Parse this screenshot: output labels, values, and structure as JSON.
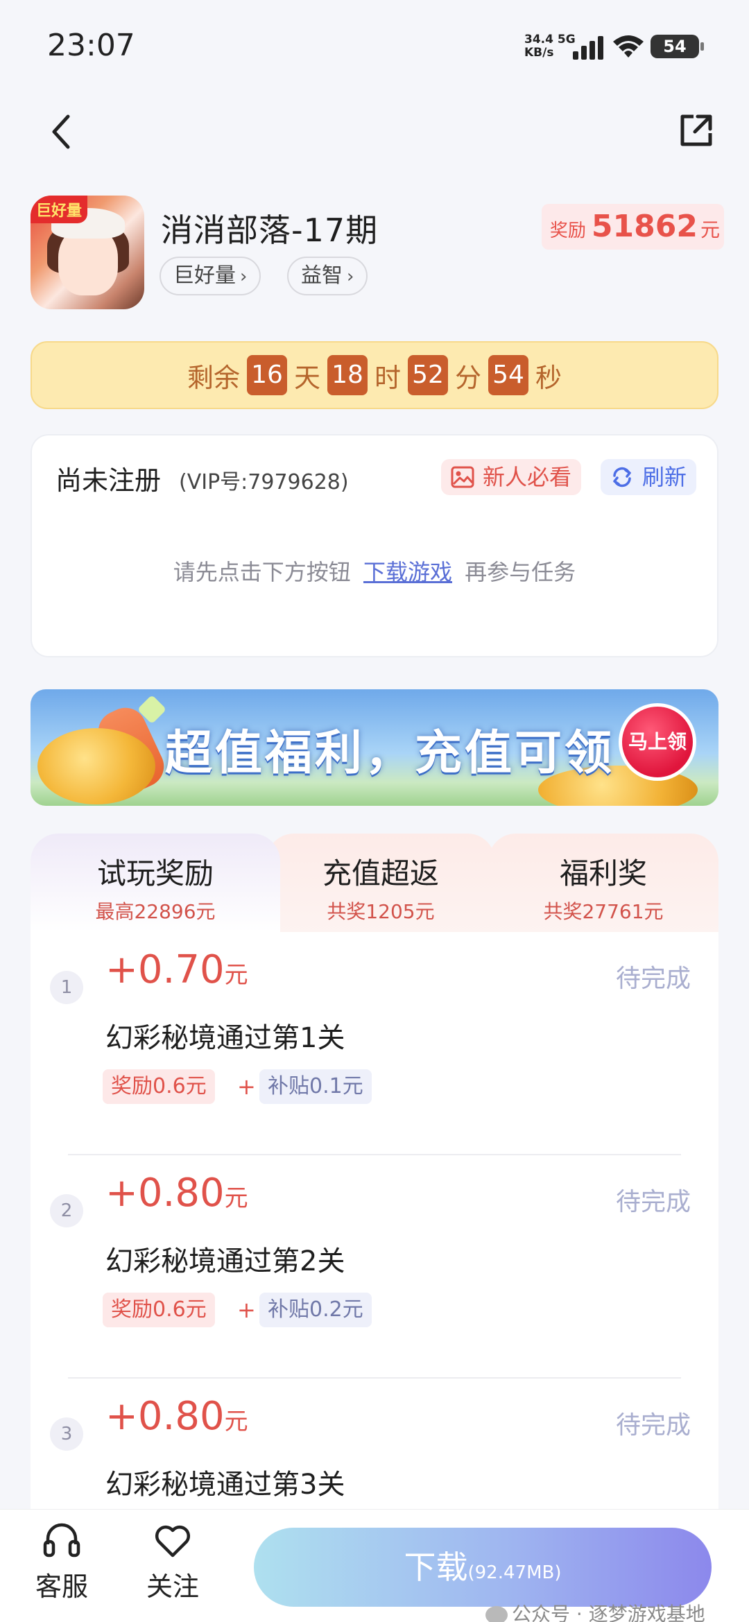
{
  "status_bar": {
    "time": "23:07",
    "net_speed_value": "34.4",
    "net_speed_unit": "KB/s",
    "network": "5G",
    "battery": "54"
  },
  "nav": {
    "back_icon": "chevron-left-icon",
    "share_icon": "share-external-icon"
  },
  "game": {
    "icon_badge": "巨好量",
    "title": "消消部落-17期",
    "tags": [
      "巨好量",
      "益智"
    ],
    "reward_label": "奖励",
    "reward_amount": "51862",
    "reward_unit": "元"
  },
  "countdown": {
    "prefix": "剩余",
    "days": "16",
    "days_label": "天",
    "hours": "18",
    "hours_label": "时",
    "minutes": "52",
    "minutes_label": "分",
    "seconds": "54",
    "seconds_label": "秒"
  },
  "registration": {
    "status": "尚未注册",
    "vip": "(VIP号:7979628)",
    "newbie_button": "新人必看",
    "refresh_button": "刷新",
    "hint_before": "请先点击下方按钮",
    "hint_link": "下载游戏",
    "hint_after": "再参与任务"
  },
  "banner": {
    "text": "超值福利，充值可领",
    "button": "马上领"
  },
  "tabs": [
    {
      "title": "试玩奖励",
      "sub": "最高22896元"
    },
    {
      "title": "充值超返",
      "sub": "共奖1205元"
    },
    {
      "title": "福利奖",
      "sub": "共奖27761元"
    }
  ],
  "tasks": [
    {
      "index": "1",
      "amount": "+0.70",
      "unit": "元",
      "status": "待完成",
      "desc": "幻彩秘境通过第1关",
      "reward_chip": "奖励0.6元",
      "plus": "+",
      "subsidy_chip": "补贴0.1元"
    },
    {
      "index": "2",
      "amount": "+0.80",
      "unit": "元",
      "status": "待完成",
      "desc": "幻彩秘境通过第2关",
      "reward_chip": "奖励0.6元",
      "plus": "+",
      "subsidy_chip": "补贴0.2元"
    },
    {
      "index": "3",
      "amount": "+0.80",
      "unit": "元",
      "status": "待完成",
      "desc": "幻彩秘境通过第3关"
    }
  ],
  "bottom_bar": {
    "service_label": "客服",
    "follow_label": "关注",
    "download_label": "下载",
    "download_size": "(92.47MB)"
  },
  "watermark": "公众号 · 逐梦游戏基地",
  "colors": {
    "accent_red": "#e0524a",
    "countdown_bg": "#fdeab0",
    "countdown_num": "#c95d2c",
    "link_blue": "#5a6fd6",
    "status_muted": "#a9aecf"
  }
}
